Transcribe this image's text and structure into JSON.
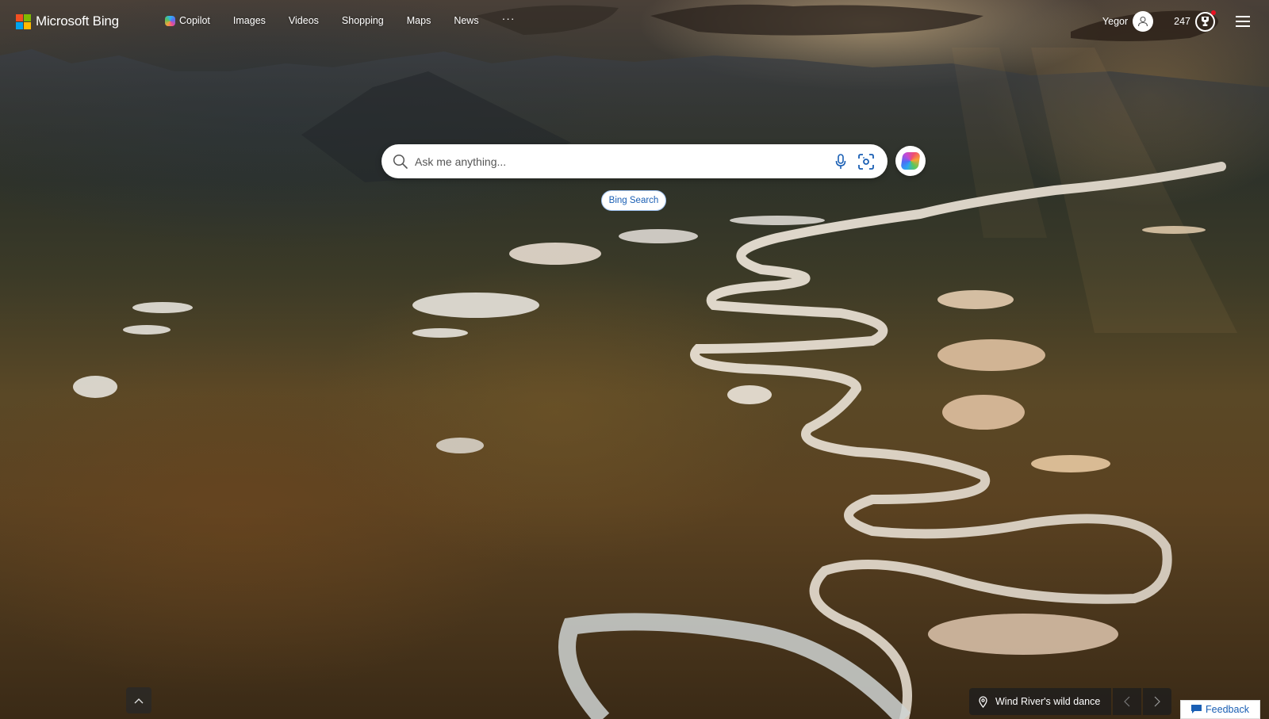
{
  "brand": {
    "name": "Microsoft Bing",
    "logo_colors": [
      "#f25022",
      "#7fba00",
      "#00a4ef",
      "#ffb900"
    ]
  },
  "nav": {
    "items": [
      {
        "label": "Copilot",
        "icon": "copilot-icon"
      },
      {
        "label": "Images"
      },
      {
        "label": "Videos"
      },
      {
        "label": "Shopping"
      },
      {
        "label": "Maps"
      },
      {
        "label": "News"
      }
    ],
    "more_label": "···"
  },
  "account": {
    "user_name": "Yegor",
    "rewards_points": "247",
    "rewards_notification": true
  },
  "search": {
    "value": "",
    "placeholder": "Ask me anything...",
    "button_label": "Bing Search",
    "accent_color": "#1a5fb4"
  },
  "background": {
    "caption": "Wind River's wild dance"
  },
  "footer": {
    "feedback_label": "Feedback"
  }
}
